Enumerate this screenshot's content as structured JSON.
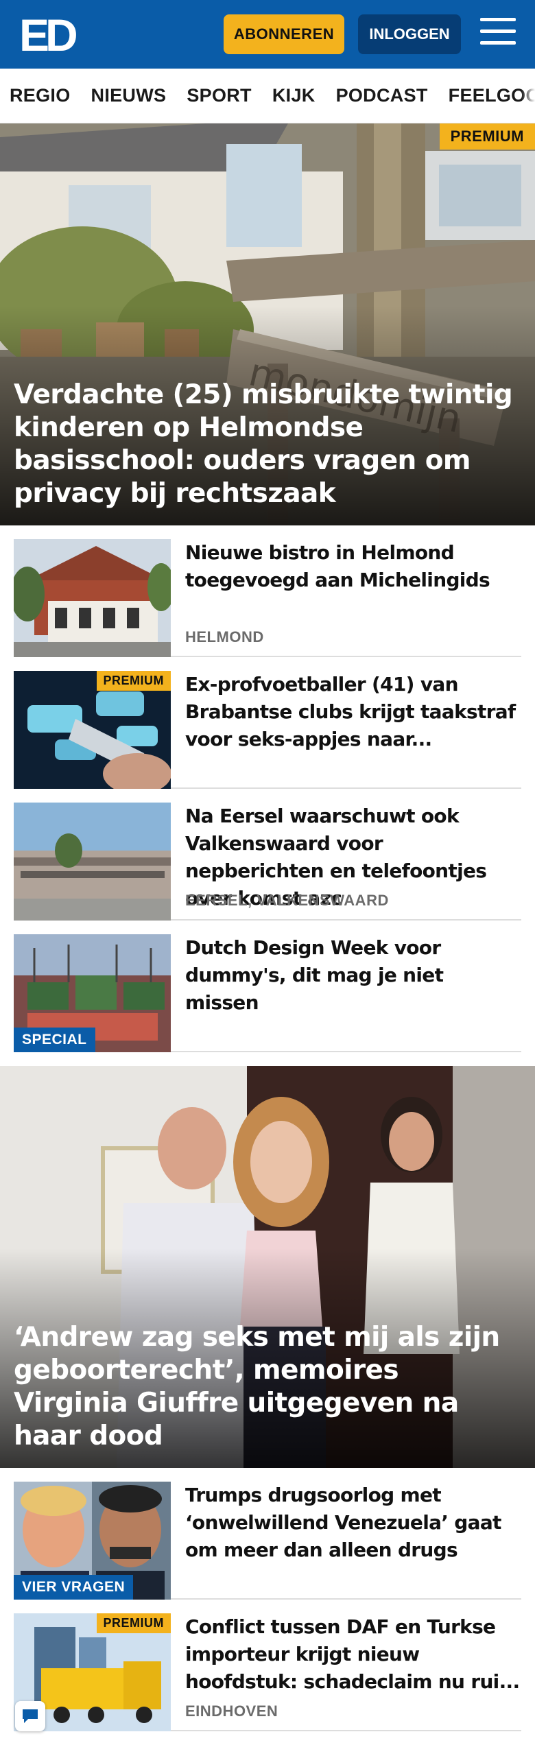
{
  "header": {
    "logo_text": "ED",
    "subscribe_label": "ABONNEREN",
    "login_label": "INLOGGEN",
    "menu_icon": "hamburger-icon",
    "brand_color": "#0a5ca8",
    "accent_color": "#f3b21d"
  },
  "nav": {
    "items": [
      "REGIO",
      "NIEUWS",
      "SPORT",
      "KIJK",
      "PODCAST",
      "FEELGOOD"
    ]
  },
  "hero": {
    "badge": "PREMIUM",
    "title": "Verdachte (25) misbruikte twintig kinderen op Helmondse basisschool: ouders vragen om privacy bij rechtszaak",
    "sign_text": "mondomijn"
  },
  "articles": [
    {
      "title": "Nieuwe bistro in Helmond toegevoegd aan Michelingids",
      "region": "HELMOND",
      "badge": "",
      "label": ""
    },
    {
      "title": "Ex-profvoetballer (41) van Brabantse clubs krijgt taakstraf voor seks-appjes naar...",
      "region": "",
      "badge": "PREMIUM",
      "label": ""
    },
    {
      "title": "Na Eersel waarschuwt ook Valkenswaard voor nepberichten en telefoontjes over komst azc",
      "region": "EERSEL, VALKENSWAARD",
      "badge": "",
      "label": ""
    },
    {
      "title": "Dutch Design Week voor dummy's, dit mag je niet missen",
      "region": "",
      "badge": "",
      "label": "SPECIAL"
    }
  ],
  "second_hero": {
    "title": "‘Andrew zag seks met mij als zijn geboorterecht’, memoires Virginia Giuffre uitgegeven na haar dood"
  },
  "articles2": [
    {
      "title": "Trumps drugsoorlog met ‘onwelwillend Venezuela’ gaat om meer dan alleen drugs",
      "region": "",
      "badge": "",
      "label": "VIER VRAGEN"
    },
    {
      "title": "Conflict tussen DAF en Turkse importeur krijgt nieuw hoofdstuk: schadeclaim nu rui...",
      "region": "EINDHOVEN",
      "badge": "PREMIUM",
      "label": ""
    }
  ]
}
